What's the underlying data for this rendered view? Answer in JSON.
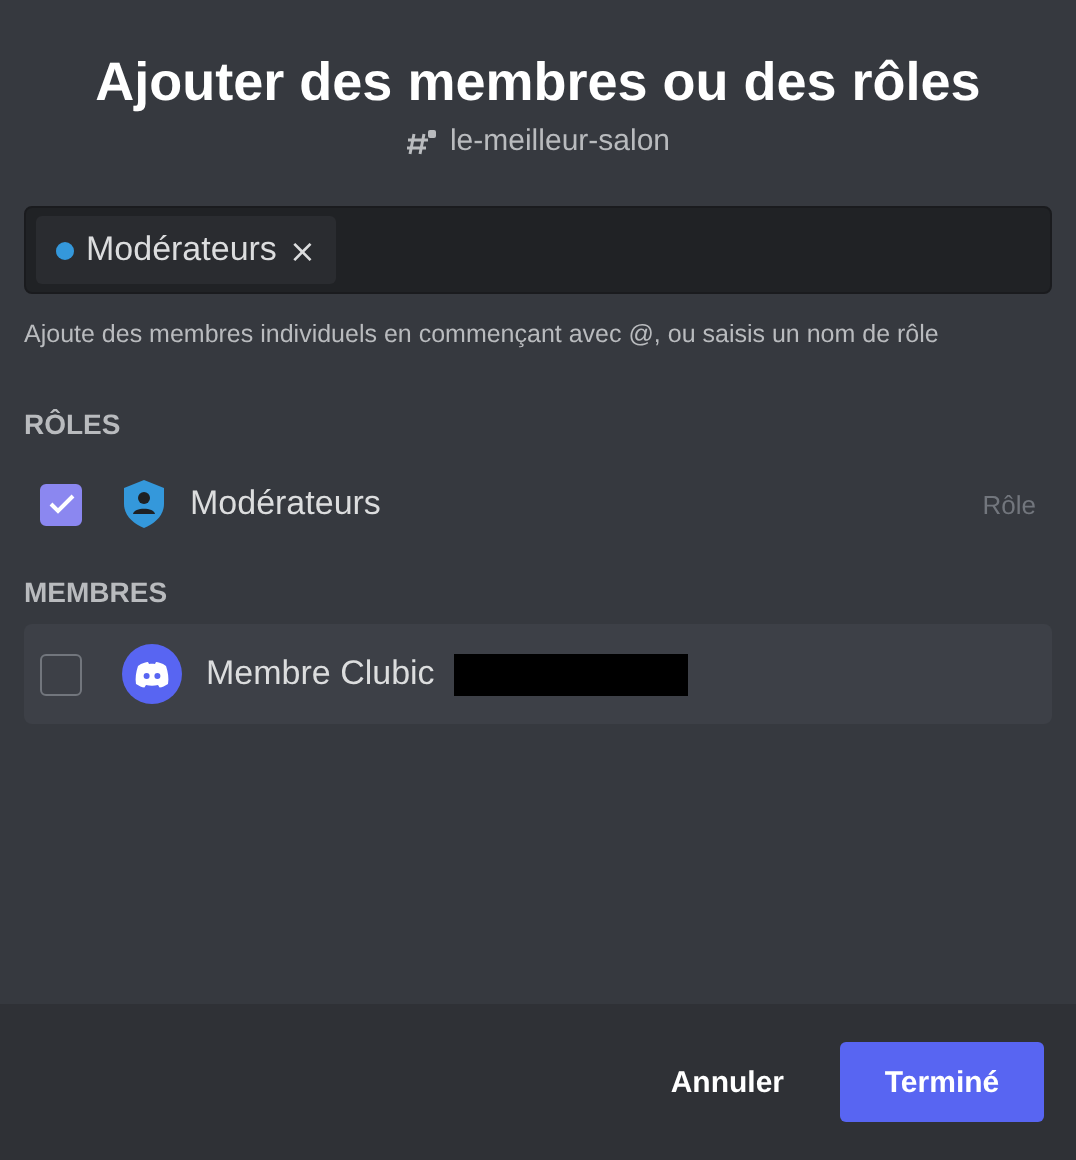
{
  "title": "Ajouter des membres ou des rôles",
  "channel": "le-meilleur-salon",
  "input": {
    "chips": [
      {
        "label": "Modérateurs",
        "color": "#3498db",
        "remove": "×"
      }
    ]
  },
  "hint": "Ajoute des membres individuels en commençant avec @, ou saisis un nom de rôle",
  "sections": [
    {
      "heading": "RÔLES",
      "items": [
        {
          "kind": "role",
          "name": "Modérateurs",
          "checked": true,
          "tag": "Rôle",
          "hovered": false
        }
      ]
    },
    {
      "heading": "MEMBRES",
      "items": [
        {
          "kind": "member",
          "name": "Membre Clubic",
          "checked": false,
          "redacted": true,
          "hovered": true
        }
      ]
    }
  ],
  "buttons": [
    {
      "label": "Annuler",
      "primary": false
    },
    {
      "label": "Terminé",
      "primary": true
    }
  ]
}
